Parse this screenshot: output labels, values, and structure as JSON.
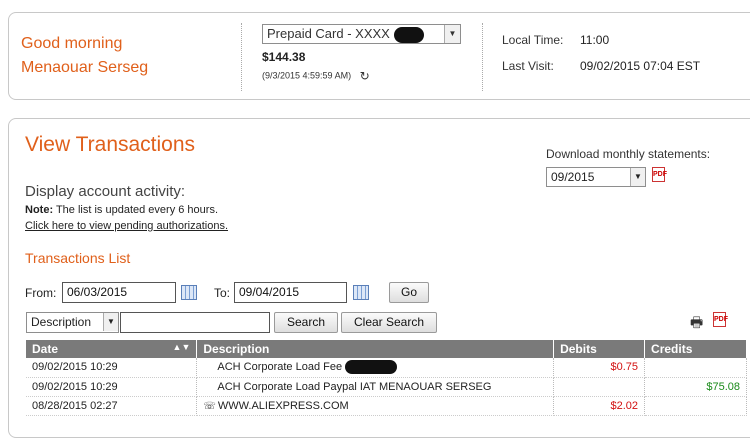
{
  "header": {
    "greeting_line1": "Good morning",
    "greeting_line2": "Menaouar Serseg",
    "account_select": "Prepaid Card - XXXX",
    "balance": "$144.38",
    "balance_date": "(9/3/2015 4:59:59 AM)",
    "local_time_label": "Local Time:",
    "local_time_value": "11:00",
    "last_visit_label": "Last Visit:",
    "last_visit_value": "09/02/2015 07:04 EST"
  },
  "main": {
    "title": "View Transactions",
    "display_heading": "Display account activity:",
    "note_label": "Note:",
    "note_text": " The list is updated every 6 hours.",
    "pending_link": "Click here to view pending authorizations.",
    "download_label": "Download monthly statements:",
    "statement_month": "09/2015",
    "section_title": "Transactions List",
    "from_label": "From:",
    "from_value": "06/03/2015",
    "to_label": "To:",
    "to_value": "09/04/2015",
    "go_button": "Go",
    "search_field_select": "Description",
    "search_value": "",
    "search_button": "Search",
    "clear_search_button": "Clear Search"
  },
  "table": {
    "headers": [
      "Date",
      "Description",
      "Debits",
      "Credits"
    ],
    "rows": [
      {
        "date": "09/02/2015 10:29",
        "description": "ACH Corporate Load Fee",
        "debit": "$0.75",
        "credit": ""
      },
      {
        "date": "09/02/2015 10:29",
        "description": "ACH Corporate Load Paypal IAT MENAOUAR SERSEG",
        "debit": "",
        "credit": "$75.08"
      },
      {
        "date": "08/28/2015 02:27",
        "description": "WWW.ALIEXPRESS.COM",
        "debit": "$2.02",
        "credit": ""
      }
    ]
  },
  "colors": {
    "accent": "#e0601b",
    "debit": "#d21010",
    "credit": "#1a8a1a",
    "table_header": "#7a7a7a"
  },
  "icons": [
    "refresh-icon",
    "pdf-icon",
    "calendar-icon",
    "printer-icon",
    "sort-icon",
    "phone-icon",
    "chevron-down-icon"
  ]
}
